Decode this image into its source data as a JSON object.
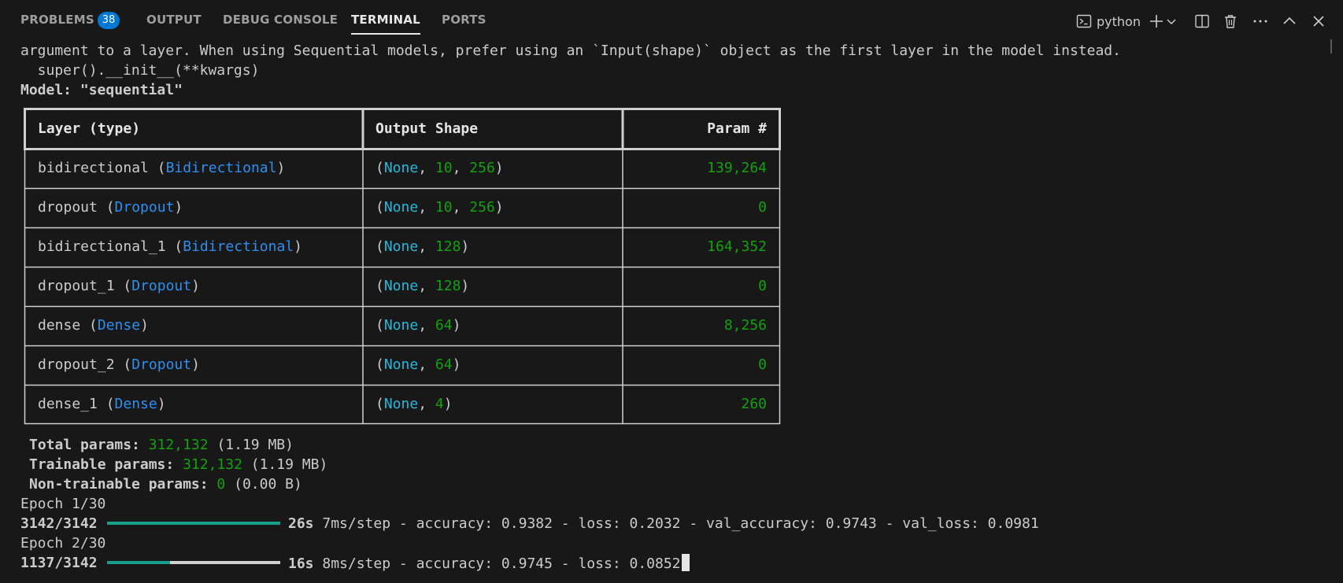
{
  "panel": {
    "tabs": [
      {
        "label": "PROBLEMS",
        "active": false
      },
      {
        "label": "OUTPUT",
        "active": false
      },
      {
        "label": "DEBUG CONSOLE",
        "active": false
      },
      {
        "label": "TERMINAL",
        "active": true
      },
      {
        "label": "PORTS",
        "active": false
      }
    ],
    "problems_count": "38",
    "shell_name": "python",
    "icons": [
      "terminal-icon",
      "plus-icon",
      "chevron-down-icon",
      "split-icon",
      "trash-icon",
      "more-icon",
      "chevron-up-icon",
      "close-icon"
    ]
  },
  "terminal": {
    "line1": "argument to a layer. When using Sequential models, prefer using an `Input(shape)` object as the first layer in the model instead.",
    "line2": "  super().__init__(**kwargs)",
    "model_line": "Model: \"sequential\"",
    "table": {
      "headers": [
        "Layer (type)",
        "Output Shape",
        "Param #"
      ],
      "rows": [
        {
          "name": "bidirectional",
          "type": "Bidirectional",
          "shape_none": "None",
          "shape_dims": [
            "10",
            "256"
          ],
          "params": "139,264"
        },
        {
          "name": "dropout",
          "type": "Dropout",
          "shape_none": "None",
          "shape_dims": [
            "10",
            "256"
          ],
          "params": "0"
        },
        {
          "name": "bidirectional_1",
          "type": "Bidirectional",
          "shape_none": "None",
          "shape_dims": [
            "128"
          ],
          "params": "164,352"
        },
        {
          "name": "dropout_1",
          "type": "Dropout",
          "shape_none": "None",
          "shape_dims": [
            "128"
          ],
          "params": "0"
        },
        {
          "name": "dense",
          "type": "Dense",
          "shape_none": "None",
          "shape_dims": [
            "64"
          ],
          "params": "8,256"
        },
        {
          "name": "dropout_2",
          "type": "Dropout",
          "shape_none": "None",
          "shape_dims": [
            "64"
          ],
          "params": "0"
        },
        {
          "name": "dense_1",
          "type": "Dense",
          "shape_none": "None",
          "shape_dims": [
            "4"
          ],
          "params": "260"
        }
      ]
    },
    "summary": {
      "total_label": "Total params:",
      "total_value": "312,132",
      "total_size": "(1.19 MB)",
      "trainable_label": "Trainable params:",
      "trainable_value": "312,132",
      "trainable_size": "(1.19 MB)",
      "nontrainable_label": "Non-trainable params:",
      "nontrainable_value": "0",
      "nontrainable_size": "(0.00 B)"
    },
    "epochs": [
      {
        "header": "Epoch 1/30",
        "step": "3142/3142",
        "progress": 1.0,
        "eta": "26s",
        "stats": "7ms/step - accuracy: 0.9382 - loss: 0.2032 - val_accuracy: 0.9743 - val_loss: 0.0981"
      },
      {
        "header": "Epoch 2/30",
        "step": "1137/3142",
        "progress": 0.362,
        "eta": "16s",
        "stats": "8ms/step - accuracy: 0.9745 - loss: 0.0852"
      }
    ]
  },
  "colors": {
    "background": "#181818",
    "accent": "#0078d4",
    "type_blue": "#2f8ff0",
    "none_cyan": "#29b8db",
    "number_green": "#13a10e",
    "progress_fill": "#1a9e8c"
  }
}
